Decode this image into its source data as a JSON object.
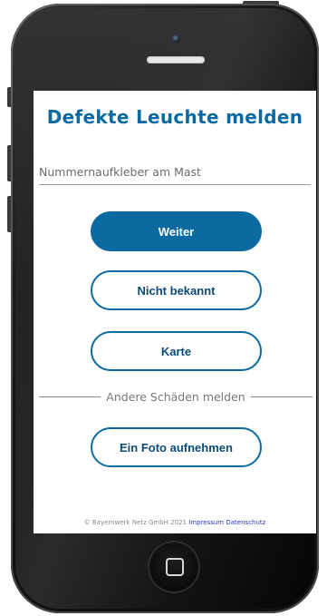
{
  "page": {
    "title": "Defekte Leuchte melden",
    "sticker_input": {
      "value": "",
      "placeholder": "Nummernaufkleber am Mast"
    },
    "buttons": {
      "next": "Weiter",
      "unknown": "Nicht bekannt",
      "map": "Karte",
      "photo": "Ein Foto aufnehmen"
    },
    "divider_label": "Andere Schäden melden",
    "footer": {
      "copyright": "© Bayernwerk Netz GmbH 2021",
      "imprint": "Impressum",
      "privacy": "Datenschutz"
    }
  },
  "colors": {
    "accent": "#0b6ba1",
    "button_text_dark": "#0c4a77",
    "link": "#2b35c9"
  },
  "icons": {
    "home_button": "home-button-icon",
    "camera": "front-camera-icon",
    "speaker": "earpiece-speaker-icon"
  }
}
